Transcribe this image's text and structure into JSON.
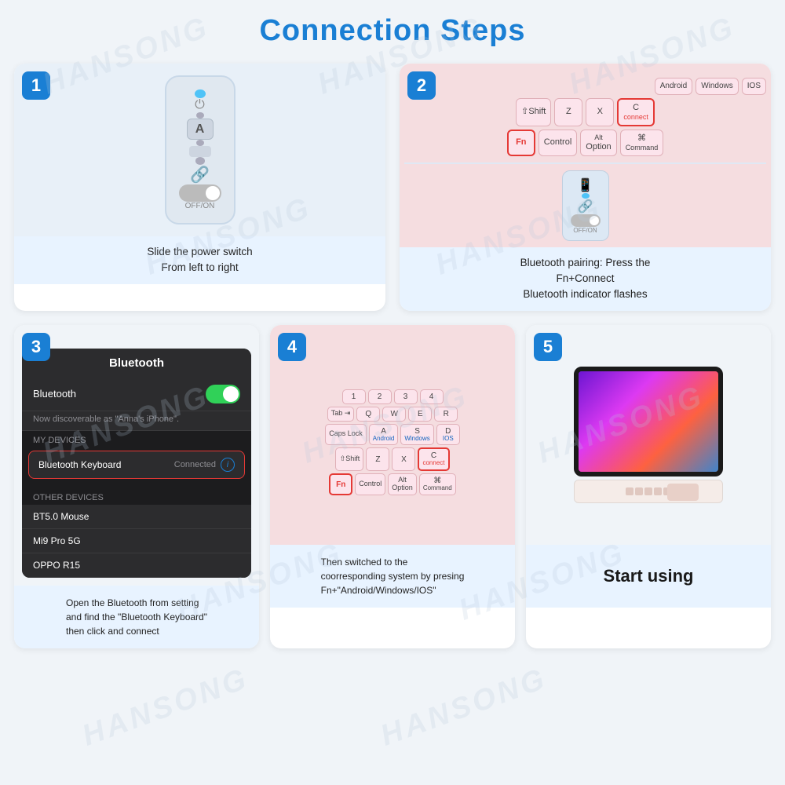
{
  "title": "Connection Steps",
  "watermarks": [
    "HANSONG",
    "HANSONG",
    "HANSONG",
    "HANSONG",
    "HANSONG",
    "HANSONG",
    "HANSONG",
    "HANSONG",
    "HANSONG"
  ],
  "step1": {
    "number": "1",
    "description": "Slide the power switch\nFrom left to right",
    "label_offon": "OFF/ON"
  },
  "step2": {
    "number": "2",
    "description": "Bluetooth pairing: Press the\nFn+Connect\nBluetooth indicator flashes",
    "keys": {
      "row1": [
        "Android",
        "Windows",
        "IOS"
      ],
      "row2": [
        "⇧Shift",
        "Z",
        "X",
        "C connect"
      ],
      "row3": [
        "Fn",
        "Control",
        "Alt\nOption",
        "⌘\nCommand"
      ]
    }
  },
  "step3": {
    "number": "3",
    "description": "Open the Bluetooth from setting\nand find the \"Bluetooth Keyboard\"\nthen click and connect",
    "bt_title": "Bluetooth",
    "bt_label": "Bluetooth",
    "bt_discoverable": "Now discoverable as \"Anna's iPhone\".",
    "my_devices": "MY DEVICES",
    "device_name": "Bluetooth Keyboard",
    "device_status": "Connected",
    "other_devices": "OTHER DEVICES",
    "other1": "BT5.0 Mouse",
    "other2": "Mi9 Pro 5G",
    "other3": "OPPO R15"
  },
  "step4": {
    "number": "4",
    "description": "Then switched to the\ncoorresponding system by presing\nFn+\"Android/Windows/IOS\"",
    "keys": {
      "numbers": [
        "1",
        "2",
        "3",
        "4"
      ],
      "row_qwer": [
        "Q",
        "W",
        "E",
        "R"
      ],
      "row_asd": [
        "A",
        "S",
        "D"
      ],
      "row_zxc": [
        "Z",
        "X",
        "C"
      ],
      "labels": [
        "Android",
        "Windows",
        "IOS",
        "connect"
      ]
    }
  },
  "step5": {
    "number": "5",
    "description": "Start using"
  }
}
